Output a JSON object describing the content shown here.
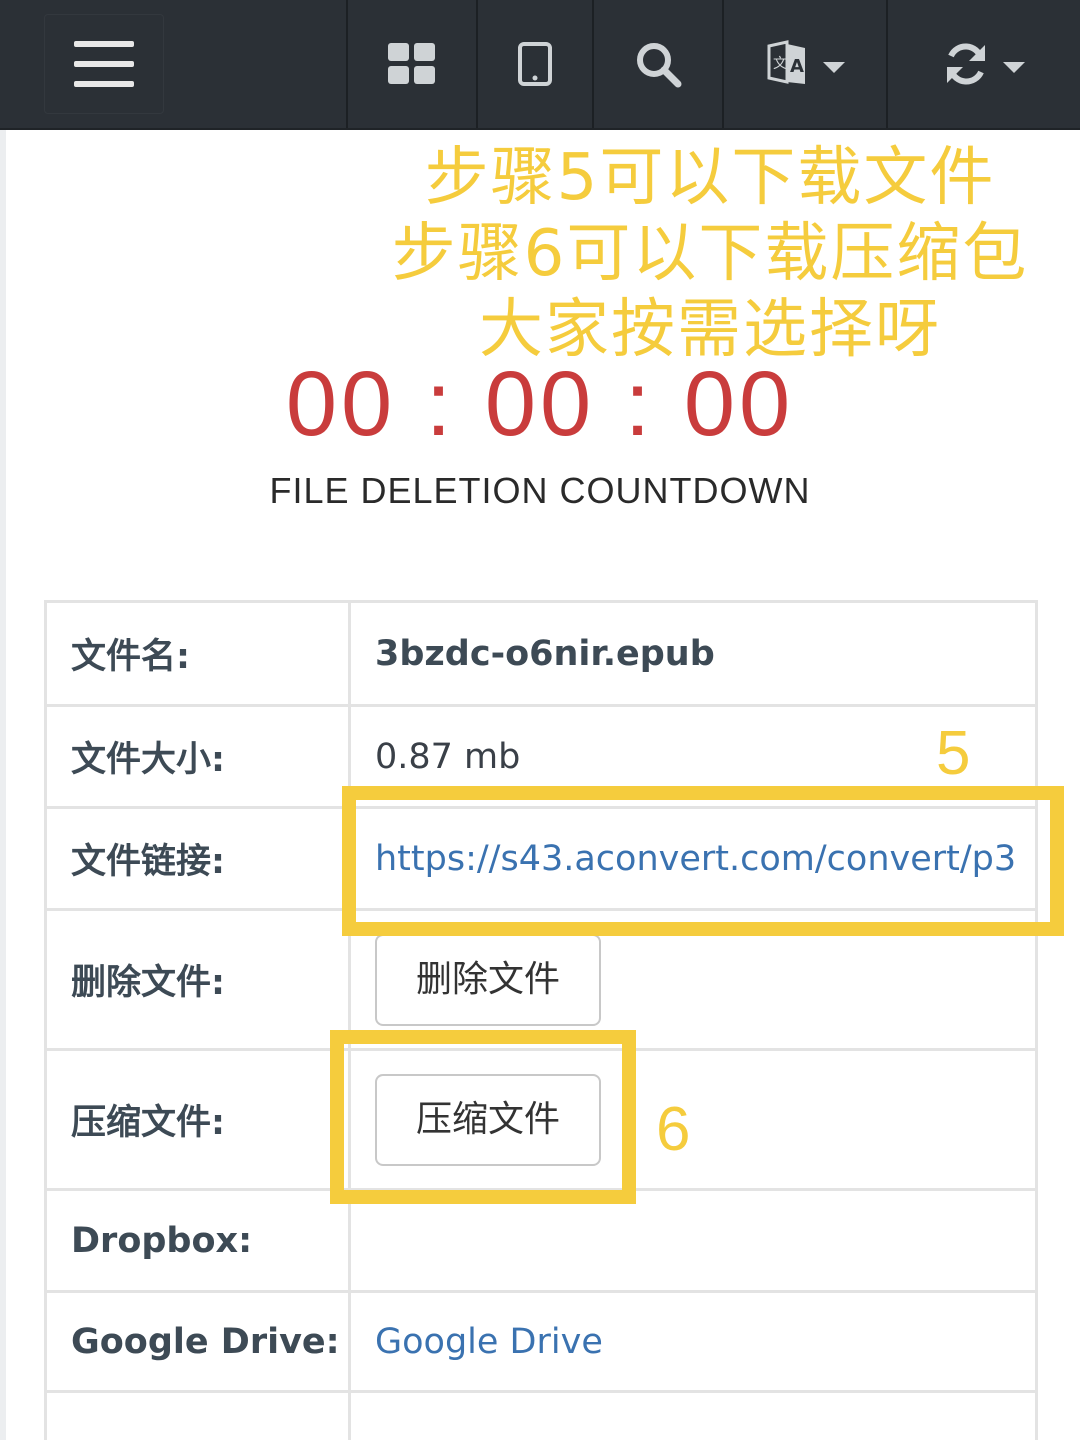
{
  "nav": {
    "icons": [
      "menu-icon",
      "grid-icon",
      "tablet-icon",
      "search-icon",
      "translate-icon",
      "refresh-icon"
    ]
  },
  "annotation": {
    "line1": "步骤5可以下载文件",
    "line2": "步骤6可以下载压缩包",
    "line3": "大家按需选择呀",
    "marker5": "5",
    "marker6": "6",
    "color": "#f5cc3d"
  },
  "countdown": {
    "time": "00 : 00 : 00",
    "label": "FILE DELETION COUNTDOWN",
    "color": "#c93c3c"
  },
  "file": {
    "name_label": "文件名:",
    "name_value": "3bzdc-o6nir.epub",
    "size_label": "文件大小:",
    "size_value": "0.87 mb",
    "link_label": "文件链接:",
    "link_value": "https://s43.aconvert.com/convert/p3",
    "delete_label": "删除文件:",
    "delete_button": "删除文件",
    "zip_label": "压缩文件:",
    "zip_button": "压缩文件",
    "dropbox_label": "Dropbox:",
    "gdrive_label": "Google Drive:",
    "gdrive_link": "Google Drive"
  }
}
